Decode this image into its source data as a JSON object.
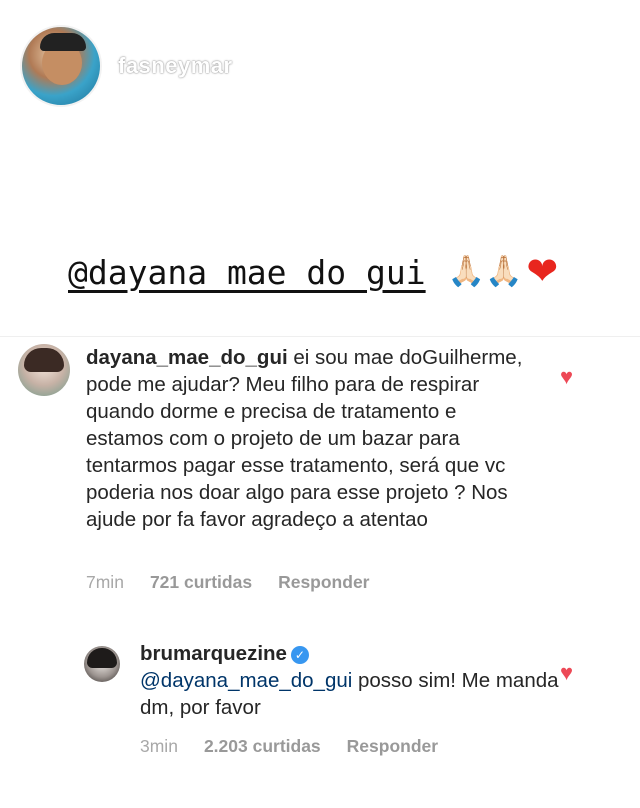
{
  "story": {
    "username": "fasneymar",
    "mention": "@dayana_mae_do_gui",
    "emojis": {
      "pray": "🙏🏻🙏🏻",
      "heart": "❤"
    }
  },
  "comments": [
    {
      "username": "dayana_mae_do_gui",
      "text": "ei sou mae doGuilherme, pode me ajudar? Meu filho para de respirar quando dorme e precisa de tratamento e estamos com o projeto de um bazar para tentarmos pagar esse tratamento, será que vc poderia nos doar algo para esse projeto ? Nos ajude por fa favor agradeço a atentao",
      "time": "7min",
      "likes": "721 curtidas",
      "reply_label": "Responder",
      "liked": true
    },
    {
      "username": "brumarquezine",
      "verified": true,
      "mention": "@dayana_mae_do_gui",
      "text": " posso sim! Me manda dm, por favor",
      "time": "3min",
      "likes": "2.203 curtidas",
      "reply_label": "Responder",
      "liked": true
    }
  ],
  "colors": {
    "heart": "#ed4956",
    "verified": "#3897f0",
    "meta": "#999999",
    "link": "#003569"
  }
}
